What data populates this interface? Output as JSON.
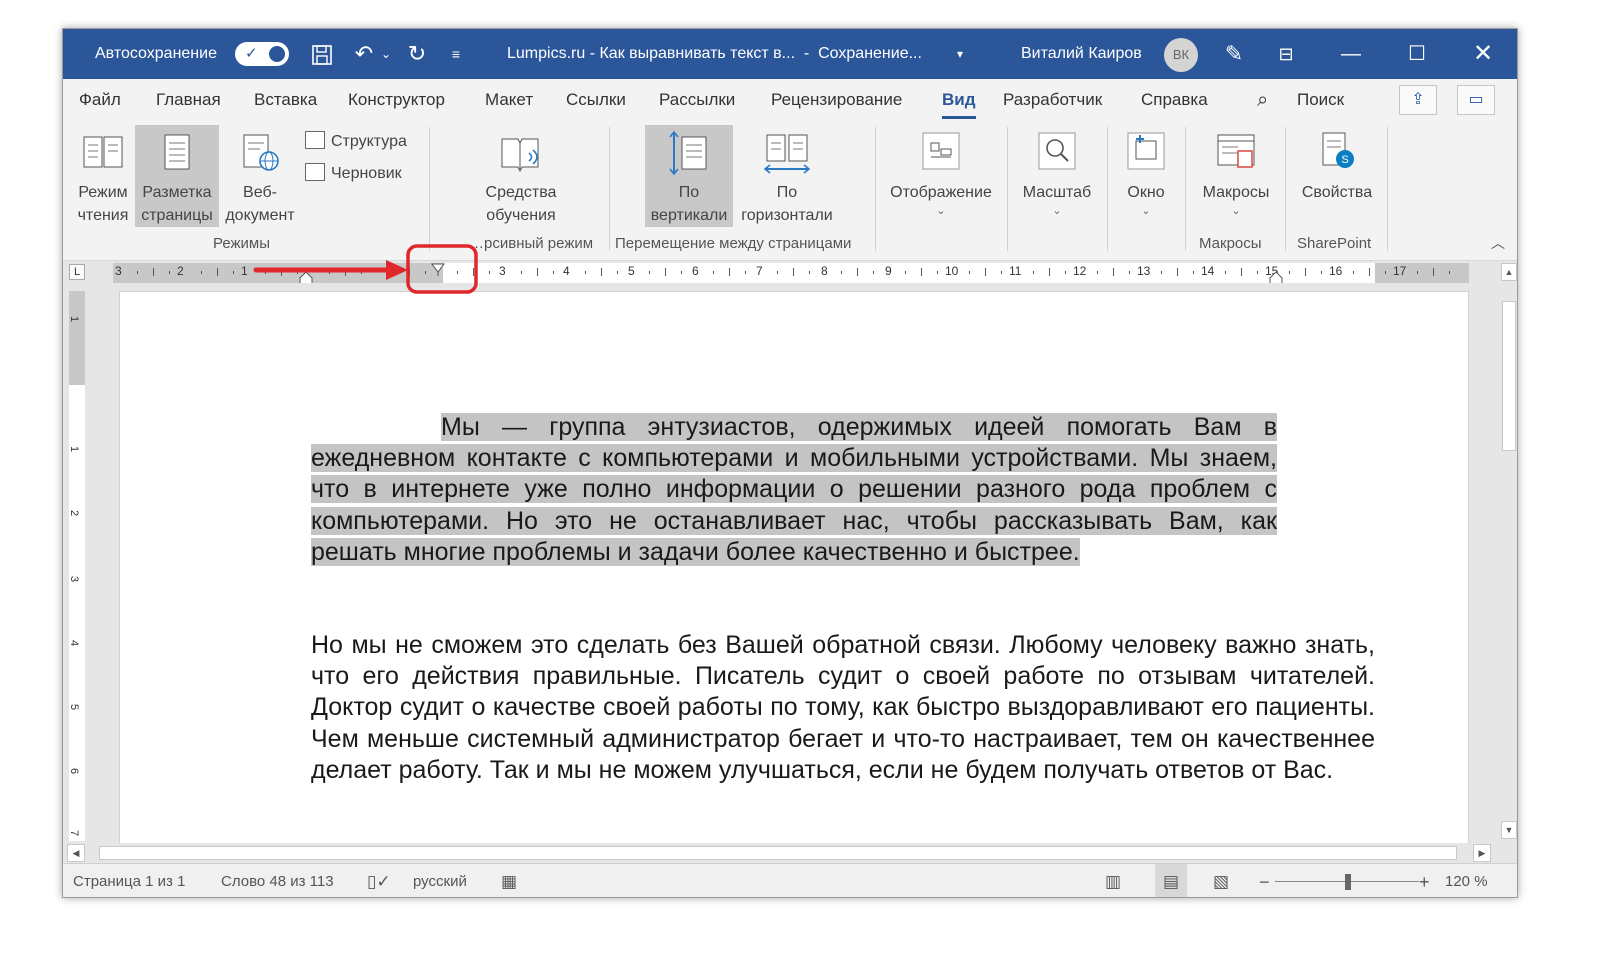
{
  "titlebar": {
    "autosave_label": "Автосохранение",
    "document_title": "Lumpics.ru - Как выравнивать текст в...  -  Сохранение...",
    "user_name": "Виталий Каиров",
    "avatar_initials": "ВК",
    "background_color": "#2b579a"
  },
  "tabs": [
    "Файл",
    "Главная",
    "Вставка",
    "Конструктор",
    "Макет",
    "Ссылки",
    "Рассылки",
    "Рецензирование",
    "Вид",
    "Разработчик",
    "Справка"
  ],
  "active_tab": "Вид",
  "search_label": "Поиск",
  "ribbon": {
    "read_mode": [
      "Режим",
      "чтения"
    ],
    "print_layout": [
      "Разметка",
      "страницы"
    ],
    "web_layout": [
      "Веб-",
      "документ"
    ],
    "outline": "Структура",
    "draft": "Черновик",
    "group_modes": "Режимы",
    "learning_tools": [
      "Средства",
      "обучения"
    ],
    "group_immersive": "…рсивный режим",
    "vertical": [
      "По",
      "вертикали"
    ],
    "side_to_side": [
      "По",
      "горизонтали"
    ],
    "group_page_movement": "Перемещение между страницами",
    "show": "Отображение",
    "zoom": "Масштаб",
    "window": "Окно",
    "macros": "Макросы",
    "group_macros": "Макросы",
    "properties": "Свойства",
    "group_sharepoint": "SharePoint"
  },
  "ruler": {
    "corner_symbol": "L",
    "left_numbers": [
      "3",
      "2",
      "1"
    ],
    "right_numbers": [
      "3",
      "4",
      "5",
      "6",
      "7",
      "8",
      "9",
      "10",
      "11",
      "12",
      "13",
      "14",
      "15",
      "16",
      "17"
    ],
    "vertical_numbers": [
      "1",
      "1",
      "2",
      "3",
      "4",
      "5",
      "6",
      "7"
    ]
  },
  "document": {
    "paragraph1_line1": "Мы — группа энтузиастов, одержимых идеей помогать Вам в ежедневном контакте с компьютерами и мобильными устройствами. Мы знаем, что в интернете уже полно информации о решении разного рода проблем с компьютерами. Но это не останавливает нас, чтобы рассказывать Вам, как решать многие проблемы и задачи более качественно и быстрее.",
    "paragraph2": "Но мы не сможем это сделать без Вашей обратной связи. Любому человеку важно знать, что его действия правильные. Писатель судит о своей работе по отзывам читателей. Доктор судит о качестве своей работы по тому, как быстро выздоравливают его пациенты. Чем меньше системный администратор бегает и что-то настраивает, тем он качественнее делает работу. Так и мы не можем улучшаться, если не будем получать ответов от Вас."
  },
  "status": {
    "page": "Страница 1 из 1",
    "words": "Слово 48 из 113",
    "language": "русский",
    "zoom_minus": "−",
    "zoom_plus": "+",
    "zoom_level": "120 %"
  },
  "colors": {
    "accent": "#2b579a",
    "annotation": "#e0272b",
    "highlight": "#c4c4c4"
  }
}
